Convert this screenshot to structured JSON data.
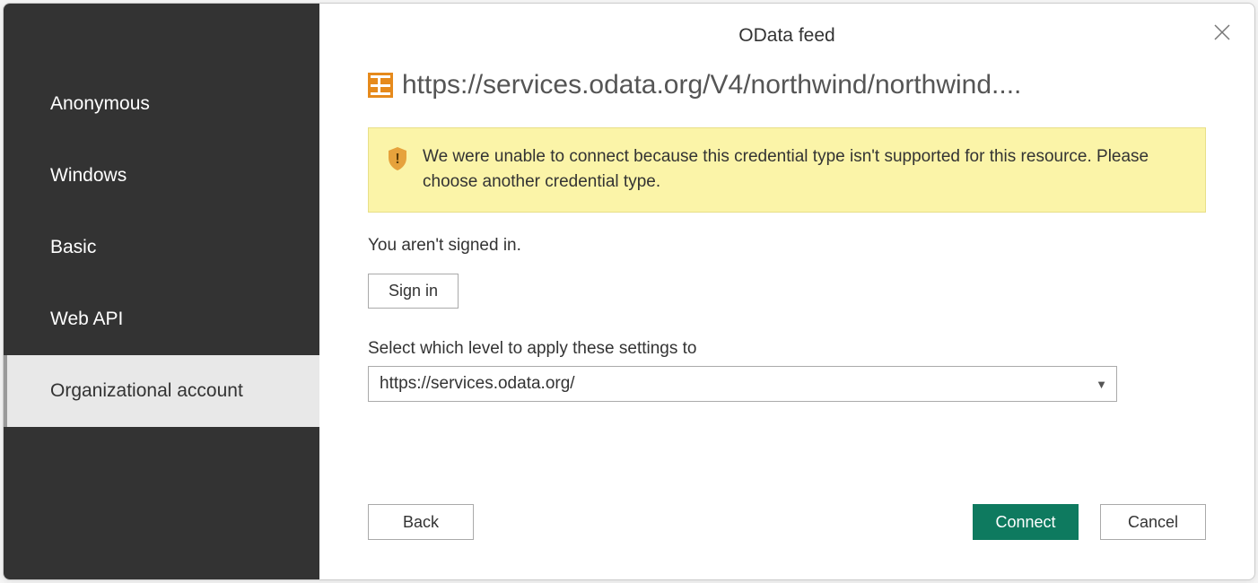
{
  "dialog": {
    "title": "OData feed",
    "url": "https://services.odata.org/V4/northwind/northwind....",
    "close_label": "Close"
  },
  "sidebar": {
    "items": [
      {
        "label": "Anonymous",
        "selected": false
      },
      {
        "label": "Windows",
        "selected": false
      },
      {
        "label": "Basic",
        "selected": false
      },
      {
        "label": "Web API",
        "selected": false
      },
      {
        "label": "Organizational account",
        "selected": true
      }
    ]
  },
  "warning": {
    "text": "We were unable to connect because this credential type isn't supported for this resource. Please choose another credential type."
  },
  "status": {
    "text": "You aren't signed in.",
    "signin_label": "Sign in"
  },
  "level": {
    "label": "Select which level to apply these settings to",
    "value": "https://services.odata.org/"
  },
  "footer": {
    "back_label": "Back",
    "connect_label": "Connect",
    "cancel_label": "Cancel"
  },
  "colors": {
    "accent": "#0e7a5f",
    "warning_bg": "#fbf4a8",
    "sidebar_bg": "#333333"
  }
}
